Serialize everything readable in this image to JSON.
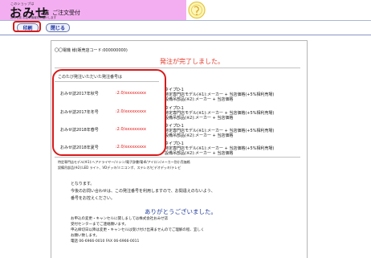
{
  "header": {
    "sub": "このショップは",
    "brand_big": "おみせ",
    "brand_mag": "誌",
    "order_label": "ご注文受付",
    "tagline": "おみせ誌 お店の情報をお届けします"
  },
  "toolbar": {
    "print_label": "印刷",
    "close_label": "閉じる"
  },
  "page": {
    "customer_line": "〇〇電機 様(販売店コード:000000000)",
    "complete_title": "発注が完了しました。",
    "lead": "このたび発注いただいた発注番号は",
    "orders": [
      {
        "label": "おみせ誌2017年秋号",
        "code": ":2.0/xxxxxxxxx"
      },
      {
        "label": "おみせ誌2017年冬号",
        "code": ":2.0/xxxxxxxxx"
      },
      {
        "label": "おみせ誌2018年春号",
        "code": ":2.0/xxxxxxxxx"
      },
      {
        "label": "おみせ誌2018年夏号",
        "code": ":2.0/xxxxxxxxx"
      }
    ],
    "details": [
      {
        "a": "タイプD-1",
        "b": "特定専門店モデル(※1):メーカー + 当店価格(+5%相利売場)",
        "c": "設備吊部品(※2):メーカー + 当店価格"
      },
      {
        "a": "タイプD-1",
        "b": "特定専門店モデル(※1):メーカー + 当店価格(+5%相利売場)",
        "c": "設備吊部品(※2):メーカー + 当店価格"
      },
      {
        "a": "タイプD-1",
        "b": "特定専門店モデル(※1):メーカー + 当店価格(+5%相利売場)",
        "c": "設備吊部品(※2):メーカー + 当店価格"
      },
      {
        "a": "タイプD-1",
        "b": "特定専門店モデル(※1):メーカー + 当店価格(+5%相利売場)",
        "c": "設備吊部品(※2):メーカー + 当店価格"
      }
    ],
    "note1": "特定専門店モデル(※1):ヘアドライヤー/ミシン/電子辞書/電卓/アイロン/メーカー別小売価格",
    "note2": "設備吊部品(※2):LED ライト、VDデッキ/ミニコンポ、ステレオ/ビデオデッキ/テレビ",
    "closing1": "となります。",
    "closing2": "今後のお問い合わせは、この発注番号を利用しますので、お間違えのないよう、",
    "closing3": "番号をお控えください。",
    "thanks": "ありがとうございました。",
    "footer1": "お申込の変更・キャンセルに関しましては株式会社おみせ誌",
    "footer2": "受付センターまでご連絡願います。",
    "footer3": "申込締切日以降は変更・キャンセルは受け付け出来ませんのでご理解の程、宜しく",
    "footer4": "お願い致します。",
    "footer5": "電話 06-6966-0010  FAX 06-6966-0011"
  }
}
